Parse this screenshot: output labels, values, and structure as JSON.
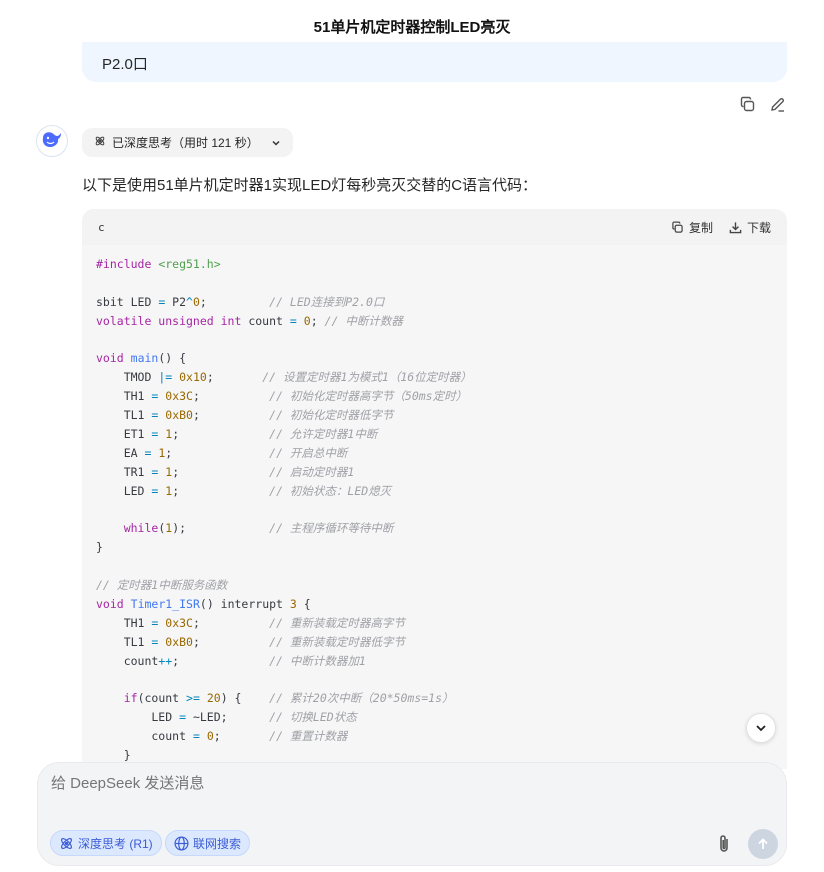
{
  "header": {
    "title": "51单片机定时器控制LED亮灭"
  },
  "user_message": {
    "text": "P2.0口"
  },
  "message_actions": [
    {
      "icon": "copy-icon"
    },
    {
      "icon": "edit-icon"
    }
  ],
  "assistant": {
    "avatar_icon": "whale-logo-icon",
    "thinking_label": "已深度思考（用时 121 秒）",
    "intro_text": "以下是使用51单片机定时器1实现LED灯每秒亮灭交替的C语言代码：",
    "code_block": {
      "language": "c",
      "copy_label": "复制",
      "download_label": "下载",
      "lines": [
        [
          [
            "kw",
            "#include "
          ],
          [
            "str",
            "<reg51.h>"
          ]
        ],
        [],
        [
          [
            "t",
            "sbit LED "
          ],
          [
            "op",
            "="
          ],
          [
            "t",
            " P2"
          ],
          [
            "op",
            "^"
          ],
          [
            "num",
            "0"
          ],
          [
            "t",
            ";         "
          ],
          [
            "cm",
            "// LED连接到P2.0口"
          ]
        ],
        [
          [
            "kw",
            "volatile unsigned int"
          ],
          [
            "t",
            " count "
          ],
          [
            "op",
            "="
          ],
          [
            "t",
            " "
          ],
          [
            "num",
            "0"
          ],
          [
            "t",
            "; "
          ],
          [
            "cm",
            "// 中断计数器"
          ]
        ],
        [],
        [
          [
            "kw",
            "void"
          ],
          [
            "t",
            " "
          ],
          [
            "fn",
            "main"
          ],
          [
            "t",
            "() {"
          ]
        ],
        [
          [
            "t",
            "    TMOD "
          ],
          [
            "op",
            "|="
          ],
          [
            "t",
            " "
          ],
          [
            "num",
            "0x10"
          ],
          [
            "t",
            ";       "
          ],
          [
            "cm",
            "// 设置定时器1为模式1（16位定时器）"
          ]
        ],
        [
          [
            "t",
            "    TH1 "
          ],
          [
            "op",
            "="
          ],
          [
            "t",
            " "
          ],
          [
            "num",
            "0x3C"
          ],
          [
            "t",
            ";          "
          ],
          [
            "cm",
            "// 初始化定时器高字节（50ms定时）"
          ]
        ],
        [
          [
            "t",
            "    TL1 "
          ],
          [
            "op",
            "="
          ],
          [
            "t",
            " "
          ],
          [
            "num",
            "0xB0"
          ],
          [
            "t",
            ";          "
          ],
          [
            "cm",
            "// 初始化定时器低字节"
          ]
        ],
        [
          [
            "t",
            "    ET1 "
          ],
          [
            "op",
            "="
          ],
          [
            "t",
            " "
          ],
          [
            "num",
            "1"
          ],
          [
            "t",
            ";             "
          ],
          [
            "cm",
            "// 允许定时器1中断"
          ]
        ],
        [
          [
            "t",
            "    EA "
          ],
          [
            "op",
            "="
          ],
          [
            "t",
            " "
          ],
          [
            "num",
            "1"
          ],
          [
            "t",
            ";              "
          ],
          [
            "cm",
            "// 开启总中断"
          ]
        ],
        [
          [
            "t",
            "    TR1 "
          ],
          [
            "op",
            "="
          ],
          [
            "t",
            " "
          ],
          [
            "num",
            "1"
          ],
          [
            "t",
            ";             "
          ],
          [
            "cm",
            "// 启动定时器1"
          ]
        ],
        [
          [
            "t",
            "    LED "
          ],
          [
            "op",
            "="
          ],
          [
            "t",
            " "
          ],
          [
            "num",
            "1"
          ],
          [
            "t",
            ";             "
          ],
          [
            "cm",
            "// 初始状态：LED熄灭"
          ]
        ],
        [],
        [
          [
            "t",
            "    "
          ],
          [
            "kw",
            "while"
          ],
          [
            "t",
            "("
          ],
          [
            "num",
            "1"
          ],
          [
            "t",
            ");            "
          ],
          [
            "cm",
            "// 主程序循环等待中断"
          ]
        ],
        [
          [
            "t",
            "}"
          ]
        ],
        [],
        [
          [
            "cm",
            "// 定时器1中断服务函数"
          ]
        ],
        [
          [
            "kw",
            "void"
          ],
          [
            "t",
            " "
          ],
          [
            "fn",
            "Timer1_ISR"
          ],
          [
            "t",
            "() interrupt "
          ],
          [
            "num",
            "3"
          ],
          [
            "t",
            " {"
          ]
        ],
        [
          [
            "t",
            "    TH1 "
          ],
          [
            "op",
            "="
          ],
          [
            "t",
            " "
          ],
          [
            "num",
            "0x3C"
          ],
          [
            "t",
            ";          "
          ],
          [
            "cm",
            "// 重新装载定时器高字节"
          ]
        ],
        [
          [
            "t",
            "    TL1 "
          ],
          [
            "op",
            "="
          ],
          [
            "t",
            " "
          ],
          [
            "num",
            "0xB0"
          ],
          [
            "t",
            ";          "
          ],
          [
            "cm",
            "// 重新装载定时器低字节"
          ]
        ],
        [
          [
            "t",
            "    count"
          ],
          [
            "op",
            "++"
          ],
          [
            "t",
            ";             "
          ],
          [
            "cm",
            "// 中断计数器加1"
          ]
        ],
        [],
        [
          [
            "t",
            "    "
          ],
          [
            "kw",
            "if"
          ],
          [
            "t",
            "(count "
          ],
          [
            "op",
            ">="
          ],
          [
            "t",
            " "
          ],
          [
            "num",
            "20"
          ],
          [
            "t",
            ") {    "
          ],
          [
            "cm",
            "// 累计20次中断（20*50ms=1s）"
          ]
        ],
        [
          [
            "t",
            "        LED "
          ],
          [
            "op",
            "="
          ],
          [
            "t",
            " ~LED;      "
          ],
          [
            "cm",
            "// 切换LED状态"
          ]
        ],
        [
          [
            "t",
            "        count "
          ],
          [
            "op",
            "="
          ],
          [
            "t",
            " "
          ],
          [
            "num",
            "0"
          ],
          [
            "t",
            ";       "
          ],
          [
            "cm",
            "// 重置计数器"
          ]
        ],
        [
          [
            "t",
            "    }"
          ]
        ]
      ]
    }
  },
  "composer": {
    "placeholder": "给 DeepSeek 发送消息",
    "deep_think_label": "深度思考 (R1)",
    "web_search_label": "联网搜索",
    "attach_icon": "paperclip-icon",
    "send_icon": "arrow-up-icon"
  }
}
